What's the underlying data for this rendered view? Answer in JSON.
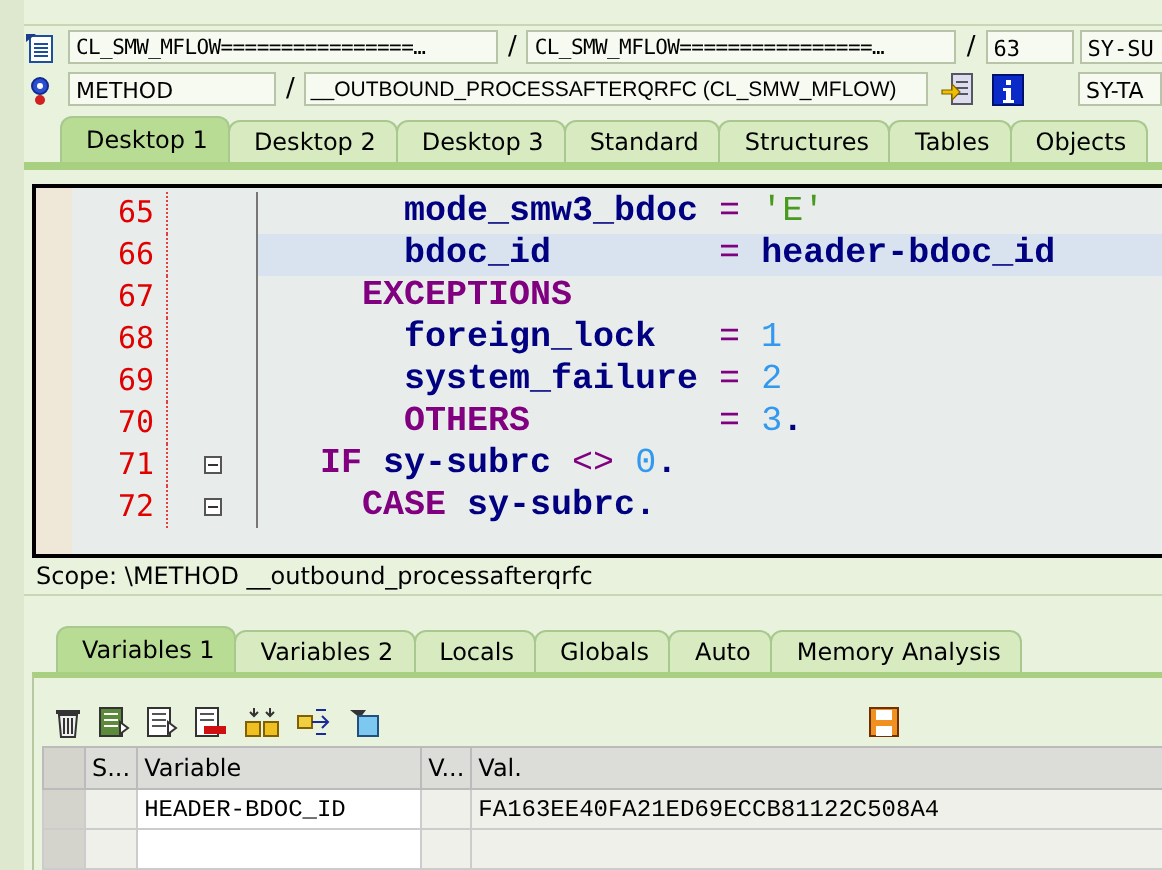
{
  "header": {
    "row1": {
      "field_1": "CL_SMW_MFLOW================…",
      "field_2": "CL_SMW_MFLOW================…",
      "line": "63",
      "field_4": "SY-SU"
    },
    "row2": {
      "field_1": "METHOD",
      "field_2": "__OUTBOUND_PROCESSAFTERQRFC (CL_SMW_MFLOW)",
      "field_4": "SY-TA"
    },
    "separator": "/"
  },
  "desktop_tabs": [
    {
      "label": "Desktop 1",
      "selected": true
    },
    {
      "label": "Desktop 2",
      "selected": false
    },
    {
      "label": "Desktop 3",
      "selected": false
    },
    {
      "label": "Standard",
      "selected": false
    },
    {
      "label": "Structures",
      "selected": false
    },
    {
      "label": "Tables",
      "selected": false
    },
    {
      "label": "Objects",
      "selected": false
    }
  ],
  "code": [
    {
      "number": "65",
      "highlighted": false,
      "foldable": false,
      "tokens": [
        {
          "kind": "ident",
          "text": "      mode_smw3_bdoc"
        },
        {
          "kind": "op",
          "text": " = "
        },
        {
          "kind": "string",
          "text": "'E'"
        }
      ]
    },
    {
      "number": "66",
      "highlighted": true,
      "foldable": false,
      "tokens": [
        {
          "kind": "ident",
          "text": "      bdoc_id"
        },
        {
          "kind": "op",
          "text": "        = "
        },
        {
          "kind": "ident",
          "text": "header-bdoc_id"
        }
      ]
    },
    {
      "number": "67",
      "highlighted": false,
      "foldable": false,
      "tokens": [
        {
          "kind": "keyword",
          "text": "    EXCEPTIONS"
        }
      ]
    },
    {
      "number": "68",
      "highlighted": false,
      "foldable": false,
      "tokens": [
        {
          "kind": "ident",
          "text": "      foreign_lock"
        },
        {
          "kind": "op",
          "text": "   = "
        },
        {
          "kind": "number",
          "text": "1"
        }
      ]
    },
    {
      "number": "69",
      "highlighted": false,
      "foldable": false,
      "tokens": [
        {
          "kind": "ident",
          "text": "      system_failure"
        },
        {
          "kind": "op",
          "text": " = "
        },
        {
          "kind": "number",
          "text": "2"
        }
      ]
    },
    {
      "number": "70",
      "highlighted": false,
      "foldable": false,
      "tokens": [
        {
          "kind": "keyword",
          "text": "      OTHERS"
        },
        {
          "kind": "op",
          "text": "         = "
        },
        {
          "kind": "number",
          "text": "3"
        },
        {
          "kind": "ident",
          "text": "."
        }
      ]
    },
    {
      "number": "71",
      "highlighted": false,
      "foldable": true,
      "tokens": [
        {
          "kind": "keyword",
          "text": "  IF"
        },
        {
          "kind": "ident",
          "text": " sy-subrc "
        },
        {
          "kind": "op",
          "text": "<>"
        },
        {
          "kind": "number",
          "text": " 0"
        },
        {
          "kind": "ident",
          "text": "."
        }
      ]
    },
    {
      "number": "72",
      "highlighted": false,
      "foldable": true,
      "tokens": [
        {
          "kind": "keyword",
          "text": "    CASE"
        },
        {
          "kind": "ident",
          "text": " sy-subrc."
        }
      ]
    }
  ],
  "scope": "Scope: \\METHOD __outbound_processafterqrfc",
  "variable_tabs": [
    {
      "label": "Variables 1",
      "selected": true
    },
    {
      "label": "Variables 2",
      "selected": false
    },
    {
      "label": "Locals",
      "selected": false
    },
    {
      "label": "Globals",
      "selected": false
    },
    {
      "label": "Auto",
      "selected": false
    },
    {
      "label": "Memory Analysis",
      "selected": false
    }
  ],
  "table": {
    "columns": [
      "S...",
      "Variable",
      "V...",
      "Val."
    ],
    "rows": [
      [
        "",
        "HEADER-BDOC_ID",
        "",
        "FA163EE40FA21ED69ECCB81122C508A4"
      ],
      [
        "",
        "",
        "",
        ""
      ]
    ]
  }
}
